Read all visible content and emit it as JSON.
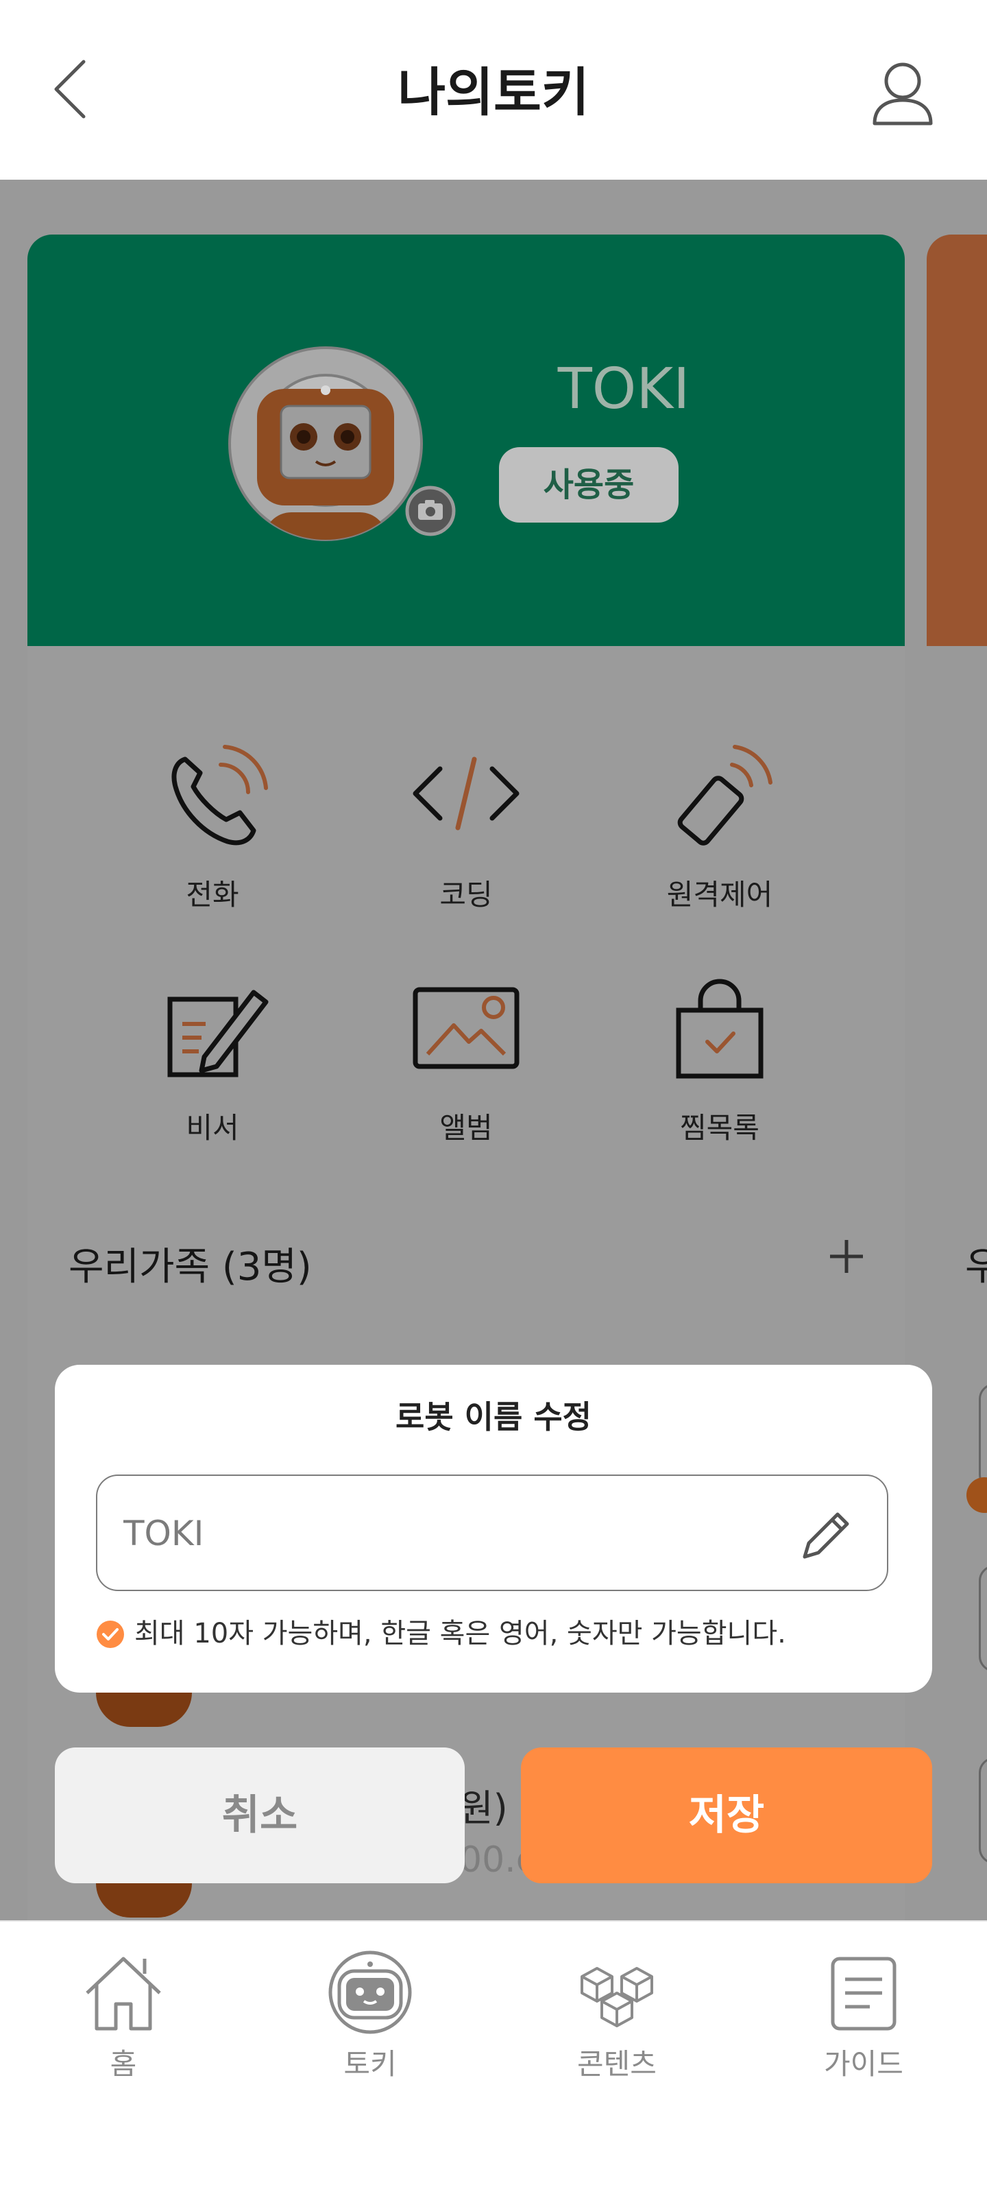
{
  "header": {
    "title": "나의토키",
    "back_icon": "chevron-left-icon",
    "user_icon": "user-icon"
  },
  "robot": {
    "name": "TOKI",
    "status": "사용중",
    "avatar_icon": "robot-avatar-icon",
    "camera_icon": "camera-icon"
  },
  "menu": [
    {
      "label": "전화",
      "icon": "phone-icon"
    },
    {
      "label": "코딩",
      "icon": "code-icon"
    },
    {
      "label": "원격제어",
      "icon": "remote-control-icon"
    },
    {
      "label": "비서",
      "icon": "secretary-icon"
    },
    {
      "label": "앨범",
      "icon": "album-icon"
    },
    {
      "label": "찜목록",
      "icon": "wishlist-icon"
    }
  ],
  "family": {
    "title": "우리가족 (3명)",
    "add_icon": "plus-icon",
    "peek_title": "우",
    "partial_name": "원)",
    "partial_email": "00.c"
  },
  "modal": {
    "title": "로봇 이름 수정",
    "input_value": "TOKI",
    "hint": "최대 10자 가능하며, 한글 혹은 영어, 숫자만 가능합니다.",
    "cancel": "취소",
    "save": "저장"
  },
  "nav": [
    {
      "label": "홈",
      "icon": "home-icon"
    },
    {
      "label": "토키",
      "icon": "toki-robot-icon"
    },
    {
      "label": "콘텐츠",
      "icon": "contents-cubes-icon"
    },
    {
      "label": "가이드",
      "icon": "guide-document-icon"
    }
  ],
  "colors": {
    "accent": "#ff8c42",
    "hero_green": "#006647",
    "robot_brown": "#9a5530",
    "scrim": "#999999"
  }
}
